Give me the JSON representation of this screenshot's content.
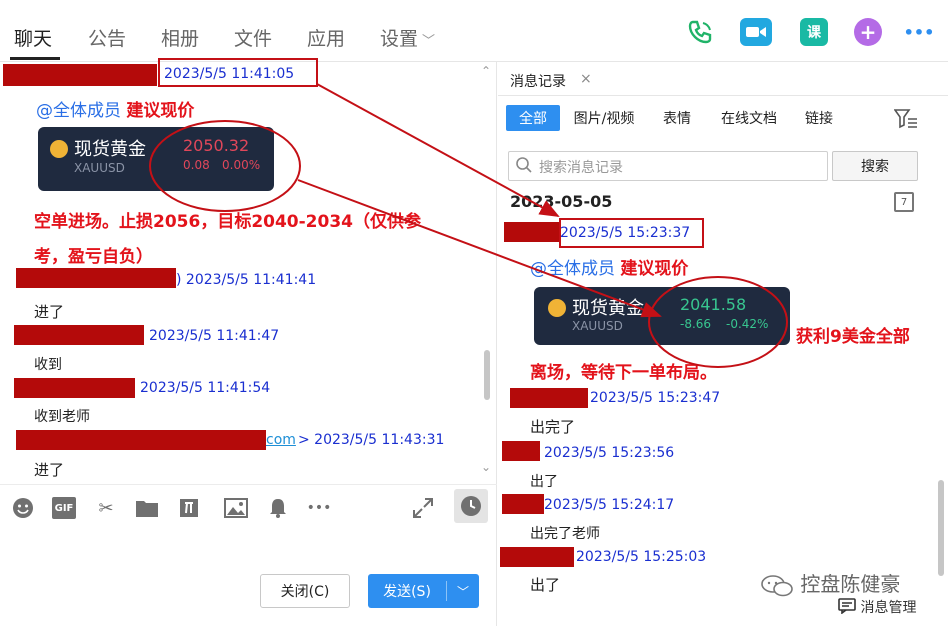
{
  "tabs": {
    "chat": "聊天",
    "notice": "公告",
    "album": "相册",
    "files": "文件",
    "apps": "应用",
    "settings": "设置"
  },
  "top_icons": {
    "course": "课",
    "plus": "+",
    "more": "•••"
  },
  "chat": {
    "msg1": {
      "time": "2023/5/5 11:41:05",
      "mention": "@全体成员",
      "text": "建议现价"
    },
    "card1": {
      "name": "现货黄金",
      "code": "XAUUSD",
      "price": "2050.32",
      "change": "0.08",
      "percent": "0.00%"
    },
    "annotation1": [
      "空单进场。止损2056，目标2040-2034（仅供参",
      "考，盈亏自负）"
    ],
    "msg2": {
      "time": ") 2023/5/5 11:41:41",
      "text": "进了"
    },
    "msg3": {
      "time": "2023/5/5 11:41:47",
      "text": "收到"
    },
    "msg4": {
      "time": "2023/5/5 11:41:54",
      "text": "收到老师"
    },
    "msg5": {
      "link": "com",
      "time": "> 2023/5/5 11:43:31",
      "text": "进了"
    }
  },
  "toolbar": {
    "gif": "GIF",
    "more": "•••"
  },
  "buttons": {
    "close": "关闭(C)",
    "send": "发送(S)"
  },
  "history": {
    "tab_title": "消息记录",
    "tab_close": "×",
    "filters": [
      "全部",
      "图片/视频",
      "表情",
      "在线文档",
      "链接"
    ],
    "search_placeholder": "搜索消息记录",
    "search_button": "搜索",
    "date": "2023-05-05",
    "calendar_day": "7",
    "msg1": {
      "time": "2023/5/5 15:23:37",
      "mention": "@全体成员",
      "text": "建议现价"
    },
    "card2": {
      "name": "现货黄金",
      "code": "XAUUSD",
      "price": "2041.58",
      "change": "-8.66",
      "percent": "-0.42%"
    },
    "annotation2": [
      "获利9美金全部",
      "离场，等待下一单布局。"
    ],
    "msg2": {
      "time": "2023/5/5 15:23:47",
      "text": "出完了"
    },
    "msg3": {
      "time": "2023/5/5 15:23:56",
      "text": "出了"
    },
    "msg4": {
      "time": "2023/5/5 15:24:17",
      "text": "出完了老师"
    },
    "msg5": {
      "time": "2023/5/5 15:25:03",
      "text": "出了"
    },
    "footer": "消息管理",
    "watermark": "控盘陈健豪"
  },
  "colors": {
    "annotation": "#e3131b",
    "accent": "#2e8ff0",
    "time": "#1a2fd0",
    "redaction": "#b40a0a",
    "card_bg": "#1f2a3f",
    "up": "#e0475a",
    "down": "#38c690"
  }
}
